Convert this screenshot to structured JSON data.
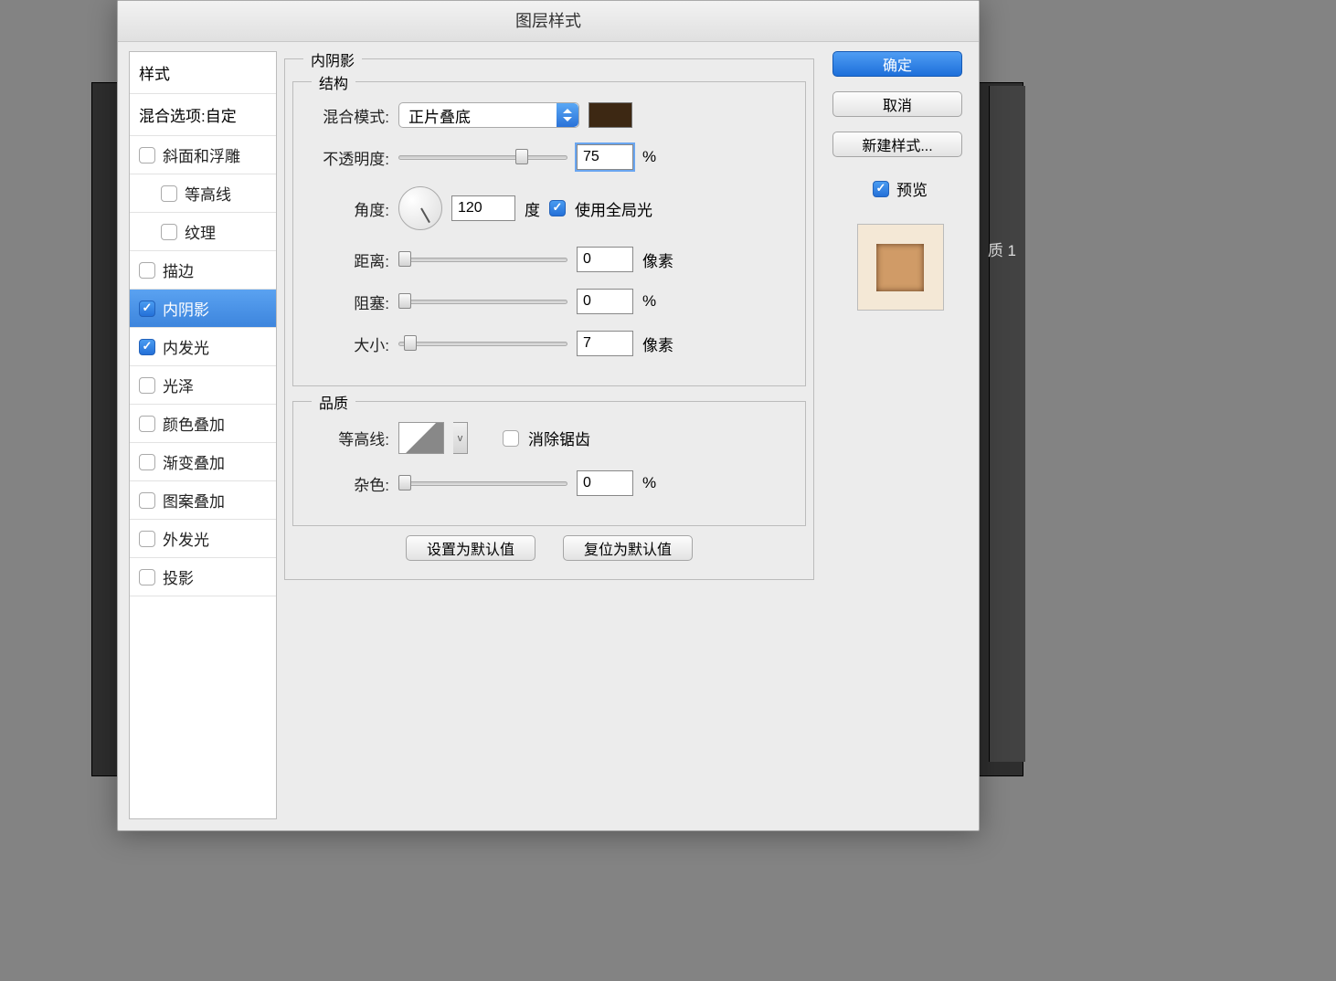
{
  "dialog": {
    "title": "图层样式",
    "section_label": "内阴影"
  },
  "side_panel_text": "质 1",
  "styles_list": {
    "header": "样式",
    "blend_options": "混合选项:自定",
    "items": [
      {
        "label": "斜面和浮雕",
        "checked": false,
        "selected": false,
        "indent": 0,
        "hasbox": true
      },
      {
        "label": "等高线",
        "checked": false,
        "selected": false,
        "indent": 1,
        "hasbox": true
      },
      {
        "label": "纹理",
        "checked": false,
        "selected": false,
        "indent": 1,
        "hasbox": true
      },
      {
        "label": "描边",
        "checked": false,
        "selected": false,
        "indent": 0,
        "hasbox": true
      },
      {
        "label": "内阴影",
        "checked": true,
        "selected": true,
        "indent": 0,
        "hasbox": true
      },
      {
        "label": "内发光",
        "checked": true,
        "selected": false,
        "indent": 0,
        "hasbox": true
      },
      {
        "label": "光泽",
        "checked": false,
        "selected": false,
        "indent": 0,
        "hasbox": true
      },
      {
        "label": "颜色叠加",
        "checked": false,
        "selected": false,
        "indent": 0,
        "hasbox": true
      },
      {
        "label": "渐变叠加",
        "checked": false,
        "selected": false,
        "indent": 0,
        "hasbox": true
      },
      {
        "label": "图案叠加",
        "checked": false,
        "selected": false,
        "indent": 0,
        "hasbox": true
      },
      {
        "label": "外发光",
        "checked": false,
        "selected": false,
        "indent": 0,
        "hasbox": true
      },
      {
        "label": "投影",
        "checked": false,
        "selected": false,
        "indent": 0,
        "hasbox": true
      }
    ]
  },
  "structure": {
    "legend": "结构",
    "blend_mode_label": "混合模式:",
    "blend_mode_value": "正片叠底",
    "color": "#3d2813",
    "opacity_label": "不透明度:",
    "opacity_value": "75",
    "opacity_unit": "%",
    "angle_label": "角度:",
    "angle_value": "120",
    "angle_unit": "度",
    "global_light_label": "使用全局光",
    "global_light_checked": true,
    "distance_label": "距离:",
    "distance_value": "0",
    "distance_unit": "像素",
    "choke_label": "阻塞:",
    "choke_value": "0",
    "choke_unit": "%",
    "size_label": "大小:",
    "size_value": "7",
    "size_unit": "像素"
  },
  "quality": {
    "legend": "品质",
    "contour_label": "等高线:",
    "antialiased_label": "消除锯齿",
    "antialiased_checked": false,
    "noise_label": "杂色:",
    "noise_value": "0",
    "noise_unit": "%"
  },
  "defaults": {
    "set_default": "设置为默认值",
    "reset_default": "复位为默认值"
  },
  "buttons": {
    "ok": "确定",
    "cancel": "取消",
    "new_style": "新建样式...",
    "preview": "预览"
  }
}
